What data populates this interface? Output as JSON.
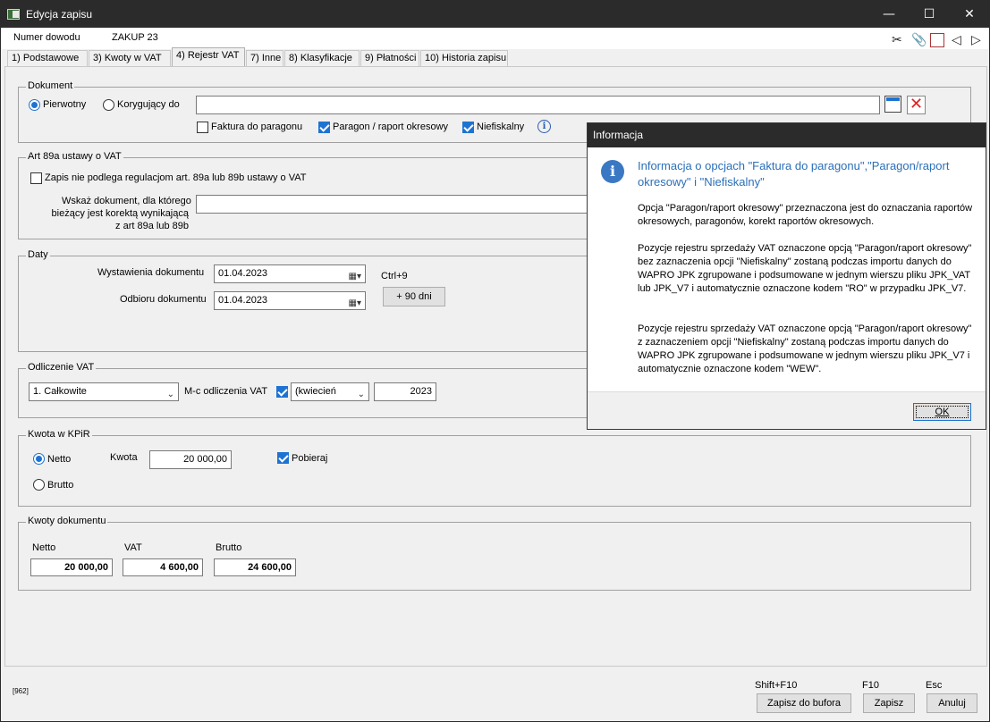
{
  "window": {
    "title": "Edycja zapisu",
    "minimize": "—",
    "maximize": "☐",
    "close": "✕"
  },
  "header": {
    "doc_label": "Numer dowodu",
    "doc_value": "ZAKUP 23",
    "icons": [
      "scissors-icon",
      "paperclip-icon",
      "report-icon",
      "prev-arrow-icon",
      "next-arrow-icon"
    ]
  },
  "tabs": [
    {
      "label": "1) Podstawowe"
    },
    {
      "label": "3) Kwoty w VAT"
    },
    {
      "label": "4) Rejestr VAT"
    },
    {
      "label": "7) Inne"
    },
    {
      "label": "8) Klasyfikacje"
    },
    {
      "label": "9) Płatności"
    },
    {
      "label": "10) Historia zapisu"
    }
  ],
  "dokument": {
    "legend": "Dokument",
    "radio_pierwotny": "Pierwotny",
    "radio_korygujacy": "Korygujący do",
    "korygujacy_value": "",
    "cb_faktura": "Faktura do paragonu",
    "cb_paragon": "Paragon / raport okresowy",
    "cb_niefiskalny": "Niefiskalny",
    "selected_radio": "Pierwotny"
  },
  "art89": {
    "legend": "Art 89a ustawy o VAT",
    "cb_label": "Zapis nie podlega regulacjom art. 89a lub 89b ustawy o VAT",
    "wskaz_line1": "Wskaż dokument, dla którego",
    "wskaz_line2": "bieżący jest korektą wynikającą",
    "wskaz_line3": "z art 89a lub 89b"
  },
  "daty": {
    "legend": "Daty",
    "wystawienia_label": "Wystawienia dokumentu",
    "wystawienia_value": "01.04.2023",
    "odbioru_label": "Odbioru dokumentu",
    "odbioru_value": "01.04.2023",
    "shortcut": "Ctrl+9",
    "plus_btn": "+ 90 dni"
  },
  "odliczenie": {
    "legend": "Odliczenie VAT",
    "type_value": "1. Całkowite",
    "mc_label": "M-c odliczenia VAT",
    "month_prefix": "(",
    "month_value": "kwiecień",
    "year_value": "2023"
  },
  "kpir": {
    "legend": "Kwota w KPiR",
    "netto": "Netto",
    "brutto": "Brutto",
    "kwota_label": "Kwota",
    "kwota_value": "20 000,00",
    "pobieraj": "Pobieraj"
  },
  "kwoty": {
    "legend": "Kwoty dokumentu",
    "netto_label": "Netto",
    "vat_label": "VAT",
    "brutto_label": "Brutto",
    "netto_value": "20 000,00",
    "vat_value": "4 600,00",
    "brutto_value": "24 600,00"
  },
  "footer": {
    "code": "[962]",
    "shift_f10": "Shift+F10",
    "f10": "F10",
    "esc": "Esc",
    "zapisz_bufor": "Zapisz do bufora",
    "zapisz": "Zapisz",
    "anuluj": "Anuluj"
  },
  "dialog": {
    "title": "Informacja",
    "heading": "Informacja o opcjach \"Faktura do paragonu\",\"Paragon/raport okresowy\" i \"Niefiskalny\"",
    "p1": "Opcja \"Paragon/raport okresowy\" przeznaczona jest do oznaczania raportów okresowych, paragonów, korekt raportów okresowych.",
    "p2": "Pozycje rejestru sprzedaży VAT oznaczone opcją \"Paragon/raport okresowy\" bez zaznaczenia opcji \"Niefiskalny\" zostaną podczas importu danych do WAPRO JPK zgrupowane i podsumowane w jednym wierszu pliku JPK_VAT lub JPK_V7 i automatycznie oznaczone kodem \"RO\" w przypadku JPK_V7.",
    "p3": "Pozycje rejestru sprzedaży VAT oznaczone opcją \"Paragon/raport okresowy\" z zaznaczeniem opcji \"Niefiskalny\" zostaną podczas importu danych do WAPRO JPK zgrupowane i podsumowane w jednym wierszu pliku JPK_V7 i automatycznie oznaczone kodem \"WEW\".",
    "ok": "OK"
  }
}
